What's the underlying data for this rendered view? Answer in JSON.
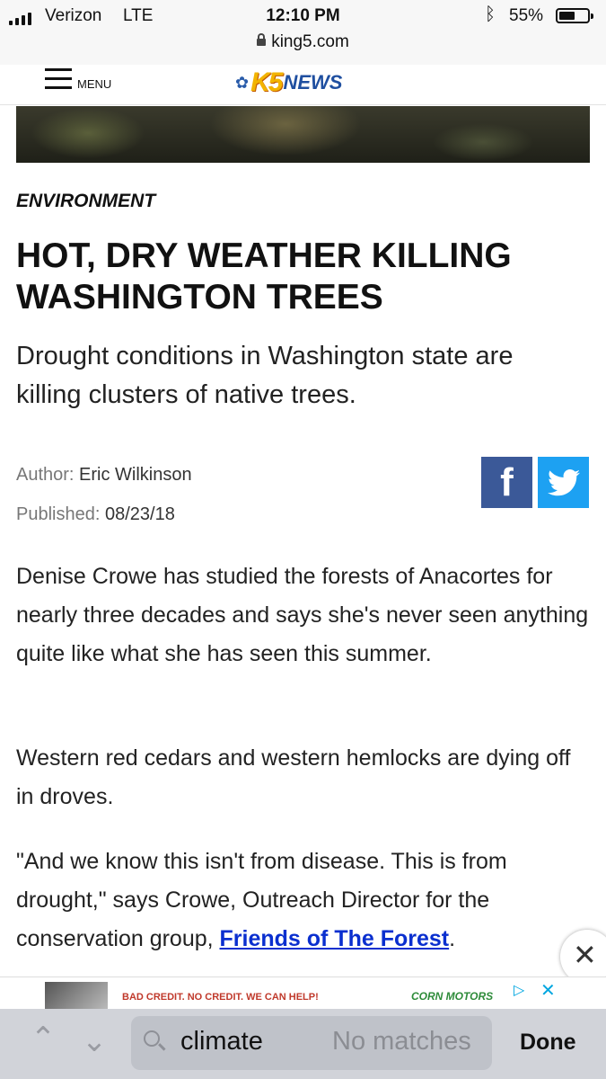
{
  "status_bar": {
    "carrier": "Verizon",
    "network": "LTE",
    "time": "12:10 PM",
    "battery_percent_label": "55%",
    "battery_level": 0.55,
    "icons": [
      "signal-bars-icon",
      "bluetooth-icon",
      "battery-icon"
    ]
  },
  "browser": {
    "url": "king5.com"
  },
  "site_header": {
    "menu_label": "MENU",
    "logo_k5": "K5",
    "logo_news": "NEWS"
  },
  "article": {
    "section": "ENVIRONMENT",
    "headline": "HOT, DRY WEATHER KILLING WASHINGTON TREES",
    "subhead": "Drought conditions in Washington state are killing clusters of native trees.",
    "author_label": "Author:",
    "author": "Eric Wilkinson",
    "published_label": "Published:",
    "published": "08/23/18",
    "paragraphs": [
      "Denise Crowe has studied the forests of Anacortes for nearly three decades and says she's never seen anything quite like what she has seen this summer.",
      "Western red cedars and western hemlocks are dying off in droves."
    ],
    "p3_text": "\"And we know this isn't from disease. This is from drought,\" says Crowe, Outreach Director for the conservation group, ",
    "p3_link": "Friends of The Forest",
    "p3_end": "."
  },
  "share": {
    "facebook_label": "f"
  },
  "ad": {
    "text": "BAD CREDIT. NO CREDIT. WE CAN HELP!",
    "brand": "CORN MOTORS"
  },
  "find_bar": {
    "query": "climate",
    "status": "No matches",
    "done_label": "Done"
  },
  "colors": {
    "link": "#0a2fcf",
    "facebook": "#3b5998",
    "twitter": "#1da1f2",
    "logo_gold": "#f2b400",
    "logo_blue": "#1f4fa0"
  }
}
